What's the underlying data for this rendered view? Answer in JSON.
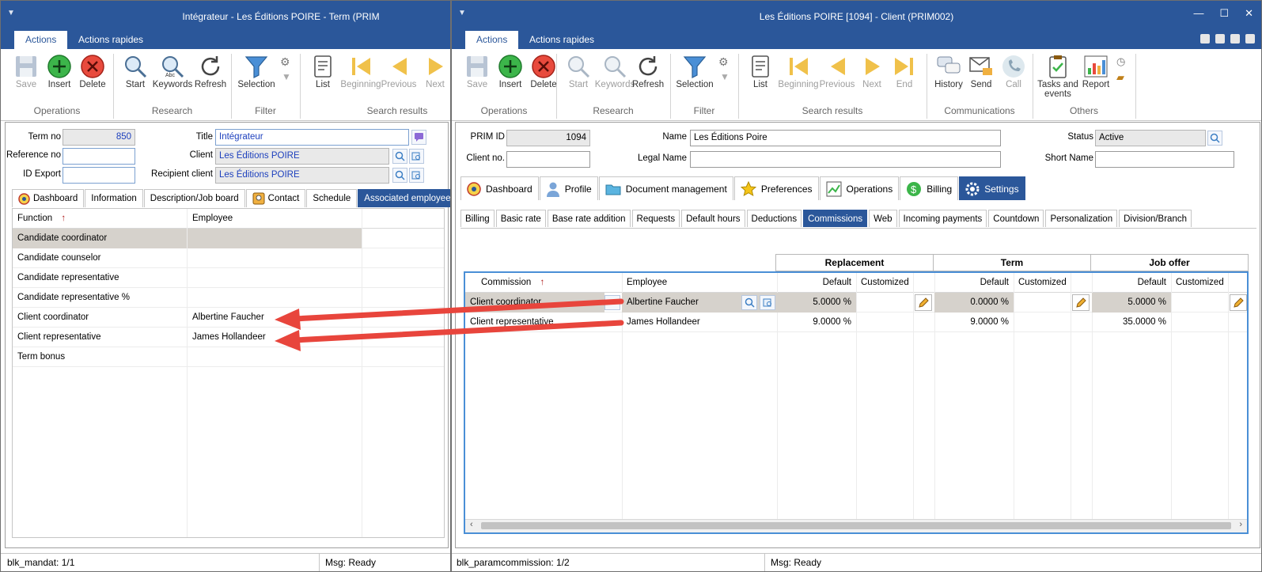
{
  "left": {
    "title": "Intégrateur - Les Éditions POIRE - Term (PRIM",
    "ribbon_tabs": [
      "Actions",
      "Actions rapides"
    ],
    "buttons": {
      "save": "Save",
      "insert": "Insert",
      "delete": "Delete",
      "start": "Start",
      "keywords": "Keywords",
      "refresh": "Refresh",
      "selection": "Selection",
      "list": "List",
      "beginning": "Beginning",
      "previous": "Previous",
      "next": "Next"
    },
    "groups": {
      "operations": "Operations",
      "research": "Research",
      "filter": "Filter",
      "search_results": "Search results"
    },
    "form": {
      "term_no_label": "Term no",
      "term_no": "850",
      "reference_label": "Reference no",
      "reference": "",
      "id_export_label": "ID Export",
      "id_export": "",
      "title_label": "Title",
      "title": "Intégrateur",
      "client_label": "Client",
      "client": "Les Éditions POIRE",
      "recipient_label": "Recipient client",
      "recipient": "Les Éditions POIRE"
    },
    "tabs": [
      "Dashboard",
      "Information",
      "Description/Job board",
      "Contact",
      "Schedule",
      "Associated employee(s)"
    ],
    "grid": {
      "col_function": "Function",
      "col_employee": "Employee",
      "rows": [
        {
          "function": "Candidate  coordinator",
          "employee": ""
        },
        {
          "function": "Candidate counselor",
          "employee": ""
        },
        {
          "function": "Candidate representative",
          "employee": ""
        },
        {
          "function": "Candidate representative %",
          "employee": ""
        },
        {
          "function": "Client coordinator",
          "employee": "Albertine Faucher"
        },
        {
          "function": "Client representative",
          "employee": "James Hollandeer"
        },
        {
          "function": "Term bonus",
          "employee": ""
        }
      ]
    },
    "status": {
      "block": "blk_mandat: 1/1",
      "msg": "Msg: Ready"
    }
  },
  "right": {
    "title": "Les Éditions POIRE [1094] - Client (PRIM002)",
    "ribbon_tabs": [
      "Actions",
      "Actions rapides"
    ],
    "buttons": {
      "save": "Save",
      "insert": "Insert",
      "delete": "Delete",
      "start": "Start",
      "keywords": "Keywords",
      "refresh": "Refresh",
      "selection": "Selection",
      "list": "List",
      "beginning": "Beginning",
      "previous": "Previous",
      "next": "Next",
      "end": "End",
      "history": "History",
      "send": "Send",
      "call": "Call",
      "tasks_line1": "Tasks and",
      "tasks_line2": "events",
      "report": "Report"
    },
    "groups": {
      "operations": "Operations",
      "research": "Research",
      "filter": "Filter",
      "search_results": "Search results",
      "communications": "Communications",
      "others": "Others"
    },
    "form": {
      "prim_id_label": "PRIM ID",
      "prim_id": "1094",
      "client_no_label": "Client no.",
      "client_no": "",
      "name_label": "Name",
      "name": "Les Éditions Poire",
      "legal_name_label": "Legal Name",
      "legal_name": "",
      "status_label": "Status",
      "status": "Active",
      "short_name_label": "Short Name",
      "short_name": ""
    },
    "main_tabs": [
      "Dashboard",
      "Profile",
      "Document management",
      "Preferences",
      "Operations",
      "Billing",
      "Settings"
    ],
    "sub_tabs": [
      "Billing",
      "Basic rate",
      "Base rate addition",
      "Requests",
      "Default hours",
      "Deductions",
      "Commissions",
      "Web",
      "Incoming payments",
      "Countdown",
      "Personalization",
      "Division/Branch"
    ],
    "grid": {
      "group_replacement": "Replacement",
      "group_term": "Term",
      "group_job_offer": "Job offer",
      "col_commission": "Commission",
      "col_employee": "Employee",
      "col_default": "Default",
      "col_customized": "Customized",
      "rows": [
        {
          "commission": "Client coordinator",
          "employee": "Albertine Faucher",
          "rep_default": "5.0000 %",
          "term_default": "0.0000 %",
          "job_default": "5.0000 %"
        },
        {
          "commission": "Client representative",
          "employee": "James Hollandeer",
          "rep_default": "9.0000 %",
          "term_default": "9.0000 %",
          "job_default": "35.0000 %"
        }
      ]
    },
    "status": {
      "block": "blk_paramcommission: 1/2",
      "msg": "Msg: Ready"
    }
  }
}
